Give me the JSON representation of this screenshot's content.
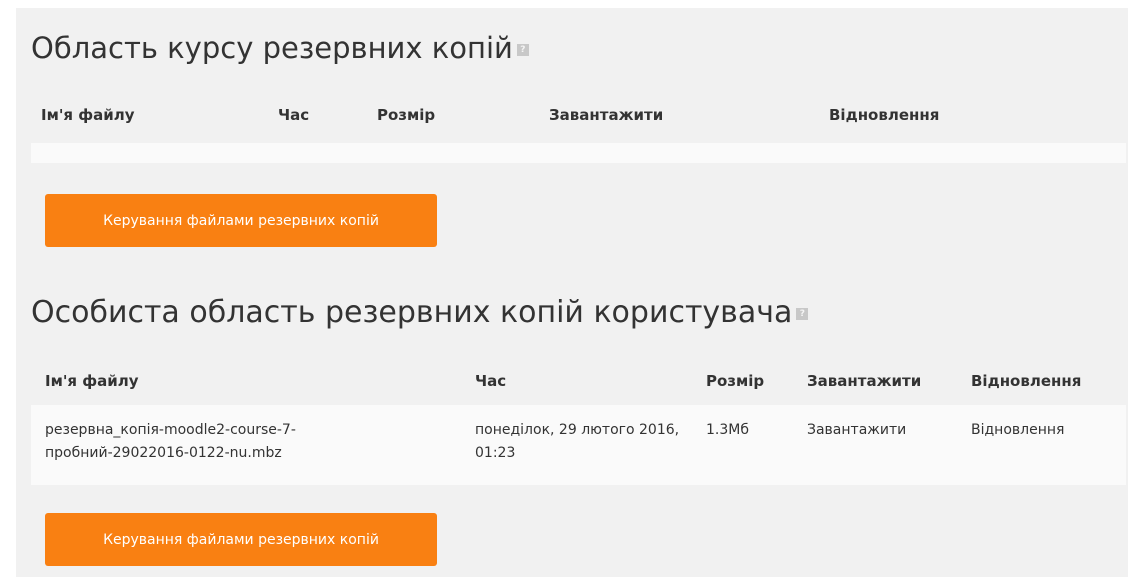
{
  "course_backup": {
    "title": "Область курсу резервних копій",
    "help_icon": "help-icon",
    "columns": [
      "Ім'я файлу",
      "Час",
      "Розмір",
      "Завантажити",
      "Відновлення"
    ],
    "rows": [],
    "manage_button": "Керування файлами резервних копій"
  },
  "user_backup": {
    "title": "Особиста область резервних копій користувача",
    "help_icon": "help-icon",
    "columns": [
      "Ім'я файлу",
      "Час",
      "Розмір",
      "Завантажити",
      "Відновлення"
    ],
    "rows": [
      {
        "filename": "резервна_копія-moodle2-course-7-пробний-29022016-0122-nu.mbz",
        "time": "понеділок, 29 лютого 2016, 01:23",
        "size": "1.3Мб",
        "download": "Завантажити",
        "restore": "Відновлення"
      }
    ],
    "manage_button": "Керування файлами резервних копій"
  },
  "colors": {
    "accent": "#f98012",
    "panel_background": "#f1f1f1",
    "row_background": "#fafafa",
    "text": "#333333"
  }
}
